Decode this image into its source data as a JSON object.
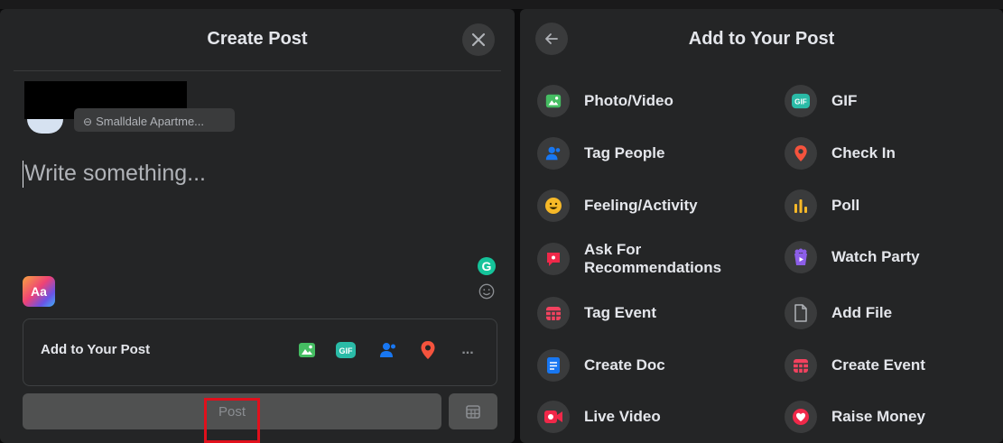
{
  "create_post": {
    "title": "Create Post",
    "audience_label": "Smalldale Apartme...",
    "placeholder": "Write something...",
    "text_format_label": "Aa",
    "grammarly_label": "G",
    "add_to_post_label": "Add to Your Post",
    "more_label": "...",
    "post_label": "Post"
  },
  "add_panel": {
    "title": "Add to Your Post",
    "left_options": [
      {
        "label": "Photo/Video",
        "icon": "photo-video-icon",
        "color": "#45bd62"
      },
      {
        "label": "Tag People",
        "icon": "tag-people-icon",
        "color": "#1877f2"
      },
      {
        "label": "Feeling/Activity",
        "icon": "feeling-icon",
        "color": "#f7b928"
      },
      {
        "label": "Ask For",
        "label2": "Recommendations",
        "icon": "recommendations-icon",
        "color": "#f02849"
      },
      {
        "label": "Tag Event",
        "icon": "tag-event-icon",
        "color": "#f3425f"
      },
      {
        "label": "Create Doc",
        "icon": "create-doc-icon",
        "color": "#1877f2"
      },
      {
        "label": "Live Video",
        "icon": "live-video-icon",
        "color": "#f02849"
      }
    ],
    "right_options": [
      {
        "label": "GIF",
        "icon": "gif-icon",
        "color": "#2abba7"
      },
      {
        "label": "Check In",
        "icon": "check-in-icon",
        "color": "#f5533d"
      },
      {
        "label": "Poll",
        "icon": "poll-icon",
        "color": "#f7b928"
      },
      {
        "label": "Watch Party",
        "icon": "watch-party-icon",
        "color": "#8c5ee8"
      },
      {
        "label": "Add File",
        "icon": "add-file-icon",
        "color": "#b0b3b8"
      },
      {
        "label": "Create Event",
        "icon": "create-event-icon",
        "color": "#f3425f"
      },
      {
        "label": "Raise Money",
        "icon": "raise-money-icon",
        "color": "#f02849"
      }
    ]
  }
}
